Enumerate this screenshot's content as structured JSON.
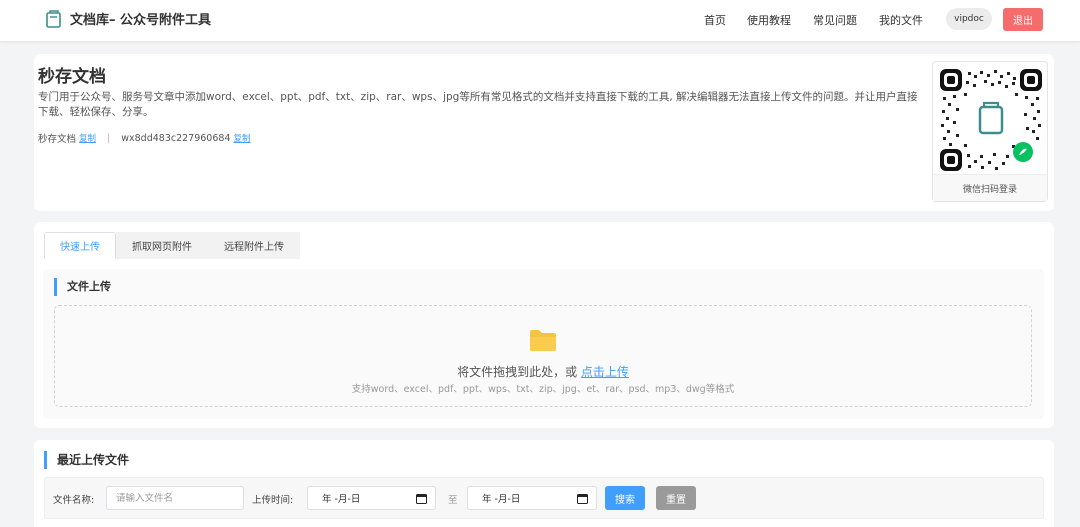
{
  "header": {
    "logo_text": "文档库– 公众号附件工具",
    "nav": [
      "首页",
      "使用教程",
      "常见问题",
      "我的文件"
    ],
    "user": "vipdoc",
    "logout": "退出"
  },
  "hero": {
    "title": "秒存文档",
    "description": "专门用于公众号、服务号文章中添加word、excel、ppt、pdf、txt、zip、rar、wps、jpg等所有常见格式的文档并支持直接下载的工具, 解决编辑器无法直接上传文件的问题。并让用户直接下载、轻松保存、分享。",
    "name_label": "秒存文档",
    "copy1": "复制",
    "appid": "wx8dd483c227960684",
    "copy2": "复制",
    "qr_caption": "微信扫码登录"
  },
  "upload": {
    "tabs": [
      "快速上传",
      "抓取网页附件",
      "远程附件上传"
    ],
    "active_tab": 0,
    "section_title": "文件上传",
    "drop_text": "将文件拖拽到此处，或 ",
    "drop_link": "点击上传",
    "drop_hint": "支持word、excel、pdf、ppt、wps、txt、zip、jpg、et、rar、psd、mp3、dwg等格式"
  },
  "recent": {
    "title": "最近上传文件",
    "filename_label": "文件名称:",
    "filename_placeholder": "请输入文件名",
    "time_label": "上传时间:",
    "date_start": "年 -月-日",
    "to": "至",
    "date_end": "年 -月-日",
    "search": "搜索",
    "reset": "重置"
  },
  "colors": {
    "accent": "#409eff",
    "danger": "#f56c6c",
    "folder": "#f7c23f",
    "mini_program": "#07c160"
  }
}
